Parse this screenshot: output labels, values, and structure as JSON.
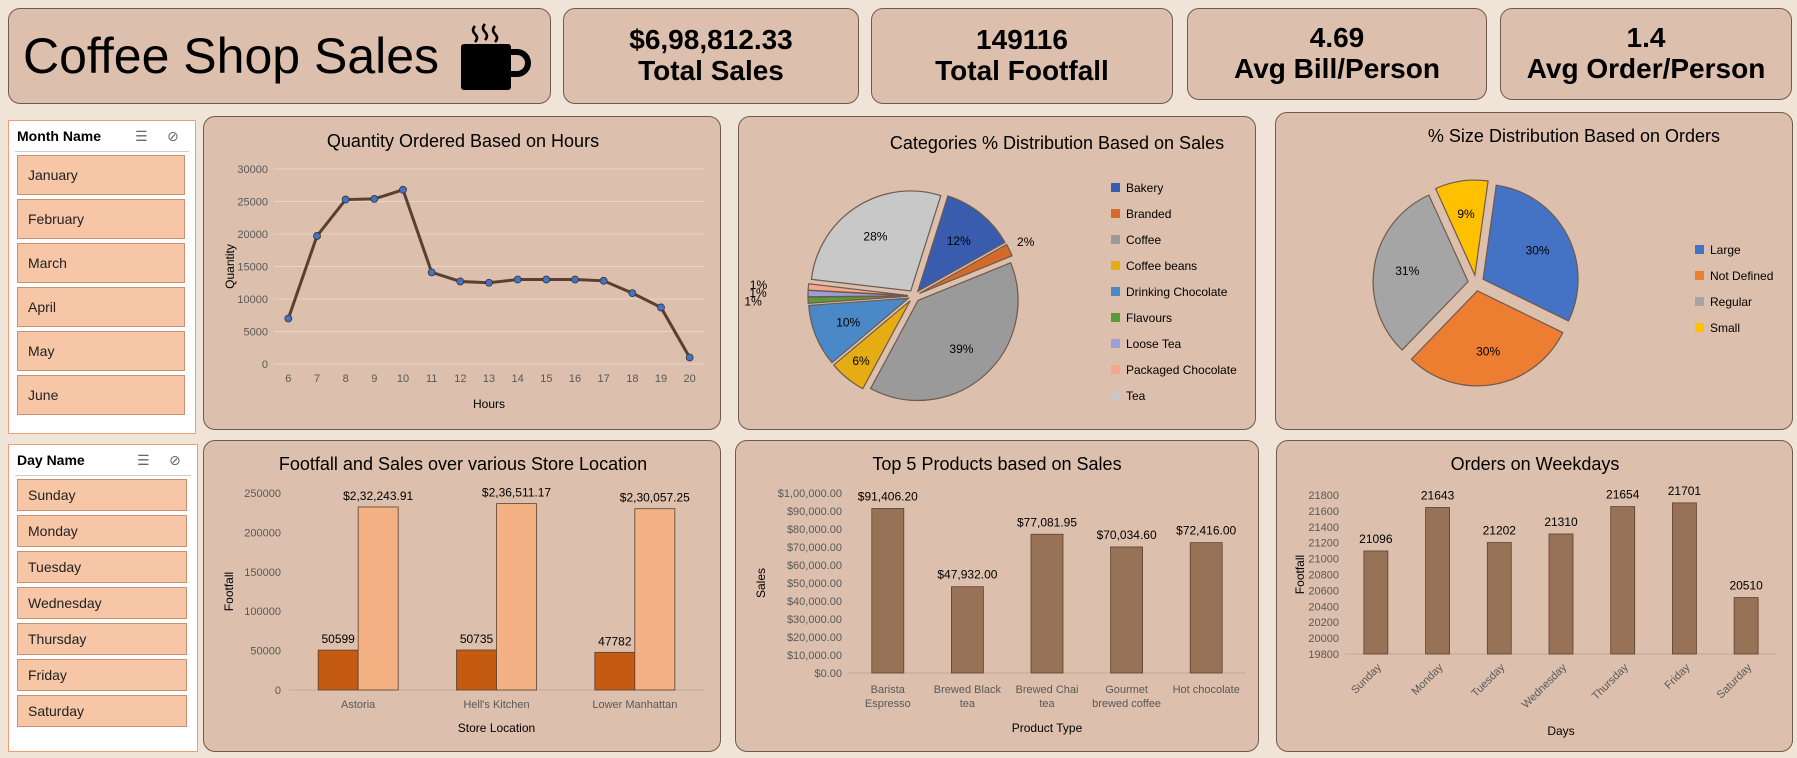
{
  "header": {
    "title": "Coffee Shop Sales",
    "icon": "coffee-cup-icon"
  },
  "kpis": [
    {
      "value": "$6,98,812.33",
      "label": "Total Sales"
    },
    {
      "value": "149116",
      "label": "Total Footfall"
    },
    {
      "value": "4.69",
      "label": "Avg Bill/Person"
    },
    {
      "value": "1.4",
      "label": "Avg Order/Person"
    }
  ],
  "slicers": {
    "month": {
      "title": "Month Name",
      "items": [
        "January",
        "February",
        "March",
        "April",
        "May",
        "June"
      ]
    },
    "day": {
      "title": "Day Name",
      "items": [
        "Sunday",
        "Monday",
        "Tuesday",
        "Wednesday",
        "Thursday",
        "Friday",
        "Saturday"
      ]
    }
  },
  "colors": {
    "line": "#5a4030",
    "bar_main": "#987257",
    "bar_footfall": "#c55a11",
    "bar_sales": "#f4b183",
    "card": "#dcbfac"
  },
  "chart_data": [
    {
      "id": "hours",
      "type": "line",
      "title": "Quantity Ordered Based on Hours",
      "xlabel": "Hours",
      "ylabel": "Quantity",
      "x": [
        6,
        7,
        8,
        9,
        10,
        11,
        12,
        13,
        14,
        15,
        16,
        17,
        18,
        19,
        20
      ],
      "values": [
        7000,
        19700,
        25300,
        25400,
        26800,
        14100,
        12700,
        12500,
        13000,
        13000,
        13000,
        12800,
        10900,
        8700,
        1000
      ],
      "ylim": [
        0,
        30000
      ],
      "yticks": [
        "0",
        "5000",
        "10000",
        "15000",
        "20000",
        "25000",
        "30000"
      ]
    },
    {
      "id": "categories",
      "type": "pie",
      "title": "Categories % Distribution Based on Sales",
      "labels": [
        "Bakery",
        "Branded",
        "Coffee",
        "Coffee beans",
        "Drinking Chocolate",
        "Flavours",
        "Loose Tea",
        "Packaged Chocolate",
        "Tea"
      ],
      "values": [
        12,
        2,
        39,
        6,
        10,
        1,
        1,
        1,
        28
      ],
      "pct_labels": [
        "12%",
        "2%",
        "39%",
        "6%",
        "10%",
        "1%",
        "1%",
        "1%",
        "28%"
      ],
      "colors": [
        "#3a5cae",
        "#d46a2a",
        "#9a9a9a",
        "#e5ad13",
        "#4a88c7",
        "#5a9a3a",
        "#9aa0d6",
        "#f2a88a",
        "#c8c8c8"
      ]
    },
    {
      "id": "sizes",
      "type": "pie",
      "title": "% Size Distribution Based on Orders",
      "labels": [
        "Large",
        "Not Defined",
        "Regular",
        "Small"
      ],
      "values": [
        30,
        30,
        31,
        9
      ],
      "pct_labels": [
        "30%",
        "30%",
        "31%",
        "9%"
      ],
      "colors": [
        "#4472c4",
        "#ed7d31",
        "#a5a5a5",
        "#ffc000"
      ]
    },
    {
      "id": "store",
      "type": "bar",
      "title": "Footfall  and Sales over various Store Location",
      "xlabel": "Store Location",
      "ylabel": "Footfall",
      "categories": [
        "Astoria",
        "Hell's Kitchen",
        "Lower Manhattan"
      ],
      "series": [
        {
          "values": [
            50599,
            50735,
            47782
          ],
          "labels": [
            "50599",
            "50735",
            "47782"
          ]
        },
        {
          "values": [
            232243.91,
            236511.17,
            230057.25
          ],
          "labels": [
            "$2,32,243.91",
            "$2,36,511.17",
            "$2,30,057.25"
          ]
        }
      ],
      "ylim": [
        0,
        250000
      ],
      "yticks": [
        "0",
        "50000",
        "100000",
        "150000",
        "200000",
        "250000"
      ]
    },
    {
      "id": "products",
      "type": "bar",
      "title": "Top 5 Products based on Sales",
      "xlabel": "Product Type",
      "ylabel": "Sales",
      "categories": [
        [
          "Barista",
          "Espresso"
        ],
        [
          "Brewed Black",
          "tea"
        ],
        [
          "Brewed Chai",
          "tea"
        ],
        [
          "Gourmet",
          "brewed coffee"
        ],
        [
          "Hot chocolate"
        ]
      ],
      "values": [
        91406.2,
        47932.0,
        77081.95,
        70034.6,
        72416.0
      ],
      "labels": [
        "$91,406.20",
        "$47,932.00",
        "$77,081.95",
        "$70,034.60",
        "$72,416.00"
      ],
      "ylim": [
        0,
        100000
      ],
      "yticks": [
        "$0.00",
        "$10,000.00",
        "$20,000.00",
        "$30,000.00",
        "$40,000.00",
        "$50,000.00",
        "$60,000.00",
        "$70,000.00",
        "$80,000.00",
        "$90,000.00",
        "$1,00,000.00"
      ]
    },
    {
      "id": "weekdays",
      "type": "bar",
      "title": "Orders on Weekdays",
      "xlabel": "Days",
      "ylabel": "Footfall",
      "categories": [
        "Sunday",
        "Monday",
        "Tuesday",
        "Wednesday",
        "Thursday",
        "Friday",
        "Saturday"
      ],
      "values": [
        21096,
        21643,
        21202,
        21310,
        21654,
        21701,
        20510
      ],
      "labels": [
        "21096",
        "21643",
        "21202",
        "21310",
        "21654",
        "21701",
        "20510"
      ],
      "ylim": [
        19800,
        21800
      ],
      "yticks": [
        "19800",
        "20000",
        "20200",
        "20400",
        "20600",
        "20800",
        "21000",
        "21200",
        "21400",
        "21600",
        "21800"
      ]
    }
  ]
}
